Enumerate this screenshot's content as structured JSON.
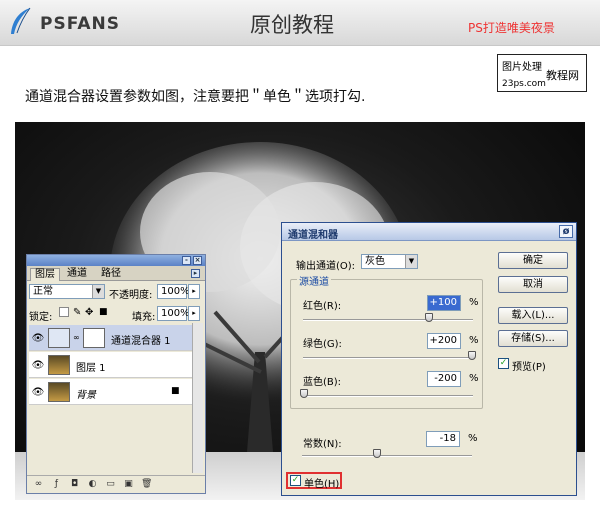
{
  "header": {
    "brand": "PSFANS",
    "title": "原创教程",
    "subtitle": "PS打造唯美夜景"
  },
  "watermark": {
    "line1": "图片处理",
    "line2": "教程网",
    "line3": "23ps.com"
  },
  "instruction": "通道混合器设置参数如图，注意要把＂单色＂选项打勾.",
  "layers_panel": {
    "tabs": [
      "图层",
      "通道",
      "路径"
    ],
    "blend_mode": "正常",
    "opacity_label": "不透明度:",
    "opacity_value": "100%",
    "lock_label": "锁定:",
    "fill_label": "填充:",
    "fill_value": "100%",
    "layers": [
      {
        "name": "通道混合器 1",
        "selected": true
      },
      {
        "name": "图层 1",
        "selected": false
      },
      {
        "name": "背景",
        "selected": false
      }
    ]
  },
  "channel_mixer": {
    "title": "通道混和器",
    "output_label": "输出通道(O):",
    "output_value": "灰色",
    "source_group": "源通道",
    "red_label": "红色(R):",
    "red_value": "+100",
    "green_label": "绿色(G):",
    "green_value": "+200",
    "blue_label": "蓝色(B):",
    "blue_value": "-200",
    "constant_label": "常数(N):",
    "constant_value": "-18",
    "percent": "%",
    "monochrome_label": "单色(H)",
    "monochrome_checked": true,
    "preview_label": "预览(P)",
    "preview_checked": true,
    "buttons": {
      "ok": "确定",
      "cancel": "取消",
      "load": "载入(L)...",
      "save": "存储(S)..."
    },
    "slider_levels": {
      "red": 100,
      "green": 200,
      "blue": -200,
      "constant": -18
    }
  },
  "colors": {
    "accent_red": "#e03030",
    "selection_blue": "#3a6ad0"
  }
}
